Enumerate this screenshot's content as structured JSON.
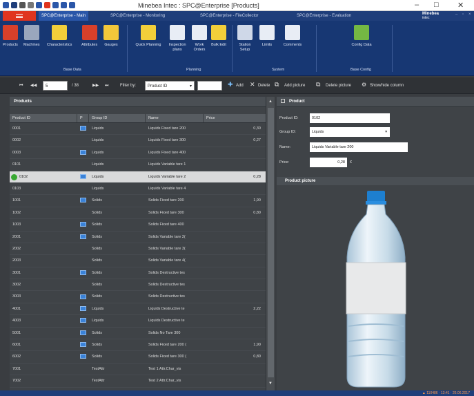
{
  "window": {
    "title": "Minebea Intec : SPC@Enterprise [Products]",
    "controls": [
      "–",
      "□",
      "✕"
    ]
  },
  "tabs": [
    {
      "label": "SPC@Enterprise - Main",
      "active": true
    },
    {
      "label": "SPC@Enterprise - Monitoring",
      "active": false
    },
    {
      "label": "SPC@Enterprise - FileCollector",
      "active": false
    },
    {
      "label": "SPC@Enterprise - Evaluation",
      "active": false
    }
  ],
  "brand": {
    "name": "Minebea",
    "sub": "intec"
  },
  "ribbon": {
    "buttons": [
      {
        "label": "Products",
        "icon": "products-icon",
        "color": "#d8402a"
      },
      {
        "label": "Machines",
        "icon": "machines-icon",
        "color": "#9aa7bd"
      },
      {
        "label": "Characteristics",
        "icon": "characteristics-icon",
        "color": "#f2cf3a"
      },
      {
        "label": "Attributes",
        "icon": "attributes-icon",
        "color": "#d8402a"
      },
      {
        "label": "Gauges",
        "icon": "gauges-icon",
        "color": "#f2c73a"
      },
      {
        "label": "Quick Planning",
        "icon": "quick-planning-icon",
        "color": "#f2cf3a"
      },
      {
        "label": "Inspection plans",
        "icon": "inspection-plans-icon",
        "color": "#e8edf5"
      },
      {
        "label": "Work Orders",
        "icon": "work-orders-icon",
        "color": "#e8edf5"
      },
      {
        "label": "Bulk Edit",
        "icon": "bulk-edit-icon",
        "color": "#f2cf3a"
      },
      {
        "label": "Station Setup",
        "icon": "station-setup-icon",
        "color": "#cfd8e8"
      },
      {
        "label": "Limits",
        "icon": "limits-icon",
        "color": "#e8edf5"
      },
      {
        "label": "Comments",
        "icon": "comments-icon",
        "color": "#e8edf5"
      },
      {
        "label": "Config Data",
        "icon": "config-data-icon",
        "color": "#74b843"
      }
    ],
    "groups": [
      "Base Data",
      "Planning",
      "System",
      "Base Config"
    ]
  },
  "toolbar": {
    "first": "⏮",
    "prev": "◀◀",
    "page": "5",
    "total": "/ 38",
    "next": "▶▶",
    "last": "⏭",
    "filter_label": "Filter by:",
    "filter_value": "Product ID",
    "filter_text": "",
    "add": "Add",
    "delete": "Delete",
    "add_picture": "Add picture",
    "delete_picture": "Delete picture",
    "show_hide": "Show/hide column"
  },
  "products_panel": {
    "title": "Products",
    "columns": [
      "Product ID",
      "P",
      "Group ID",
      "Name",
      "Price"
    ],
    "rows": [
      {
        "id": "0001",
        "flag": true,
        "group": "Liquids",
        "name": "Liquids Fixed tare 200",
        "price": "0,30",
        "selected": false,
        "status": false
      },
      {
        "id": "0002",
        "flag": false,
        "group": "Liquids",
        "name": "Liquids Fixed tare 300",
        "price": "0,27",
        "selected": false,
        "status": false
      },
      {
        "id": "0003",
        "flag": true,
        "group": "Liquids",
        "name": "Liquids Fixed tare 400",
        "price": "",
        "selected": false,
        "status": false
      },
      {
        "id": "0101",
        "flag": false,
        "group": "Liquids",
        "name": "Liquids Variable tare 1",
        "price": "",
        "selected": false,
        "status": false
      },
      {
        "id": "0102",
        "flag": true,
        "group": "Liquids",
        "name": "Liquids Variable tare 2",
        "price": "0,28",
        "selected": true,
        "status": true
      },
      {
        "id": "0103",
        "flag": false,
        "group": "Liquids",
        "name": "Liquids Variable tare 4",
        "price": "",
        "selected": false,
        "status": false
      },
      {
        "id": "1001",
        "flag": true,
        "group": "Solids",
        "name": "Solids Fixed tare 200",
        "price": "1,90",
        "selected": false,
        "status": false
      },
      {
        "id": "1002",
        "flag": false,
        "group": "Solids",
        "name": "Solids Fixed tare 300",
        "price": "0,80",
        "selected": false,
        "status": false
      },
      {
        "id": "1003",
        "flag": true,
        "group": "Solids",
        "name": "Solids Fixed tare 400",
        "price": "",
        "selected": false,
        "status": false
      },
      {
        "id": "2001",
        "flag": true,
        "group": "Solids",
        "name": "Solids Variable tare 2(",
        "price": "",
        "selected": false,
        "status": false
      },
      {
        "id": "2002",
        "flag": false,
        "group": "Solids",
        "name": "Solids Variable tare 3(",
        "price": "",
        "selected": false,
        "status": false
      },
      {
        "id": "2003",
        "flag": false,
        "group": "Solids",
        "name": "Solids Variable tare 4(",
        "price": "",
        "selected": false,
        "status": false
      },
      {
        "id": "3001",
        "flag": true,
        "group": "Solids",
        "name": "Solids Destructive tes",
        "price": "",
        "selected": false,
        "status": false
      },
      {
        "id": "3002",
        "flag": false,
        "group": "Solids",
        "name": "Solids Destructive tes",
        "price": "",
        "selected": false,
        "status": false
      },
      {
        "id": "3003",
        "flag": true,
        "group": "Solids",
        "name": "Solids Destructive tes",
        "price": "",
        "selected": false,
        "status": false
      },
      {
        "id": "4001",
        "flag": true,
        "group": "Liquids",
        "name": "Liquids Destructive te",
        "price": "2,22",
        "selected": false,
        "status": false
      },
      {
        "id": "4003",
        "flag": true,
        "group": "Liquids",
        "name": "Liquids Destructive te",
        "price": "",
        "selected": false,
        "status": false
      },
      {
        "id": "5001",
        "flag": true,
        "group": "Solids",
        "name": "Solids No Tare 300",
        "price": "",
        "selected": false,
        "status": false
      },
      {
        "id": "6001",
        "flag": true,
        "group": "Solids",
        "name": "Solids Fixed tare 200 (",
        "price": "1,90",
        "selected": false,
        "status": false
      },
      {
        "id": "6002",
        "flag": true,
        "group": "Solids",
        "name": "Solids Fixed tare 300 (",
        "price": "0,80",
        "selected": false,
        "status": false
      },
      {
        "id": "7001",
        "flag": false,
        "group": "TestAttr",
        "name": "Test 1 Attr.Char_vis",
        "price": "",
        "selected": false,
        "status": false
      },
      {
        "id": "7002",
        "flag": false,
        "group": "TestAttr",
        "name": "Test 2 Attr.Char_vis",
        "price": "",
        "selected": false,
        "status": false
      }
    ]
  },
  "product_panel": {
    "title": "Product",
    "fields": {
      "product_id_label": "Product ID:",
      "product_id": "0102",
      "group_id_label": "Group ID:",
      "group_id": "Liquids",
      "name_label": "Name:",
      "name": "Liquids Variable tare 200",
      "price_label": "Price:",
      "price": "0,28",
      "currency": "€"
    },
    "picture_title": "Product picture"
  },
  "status_bar": {
    "text": "▲ 110486 · 13:41 · 26.06.2017"
  },
  "colors": {
    "accent": "#1f3e7a",
    "file_tab": "#e0351e",
    "status_ok": "#38a832"
  }
}
